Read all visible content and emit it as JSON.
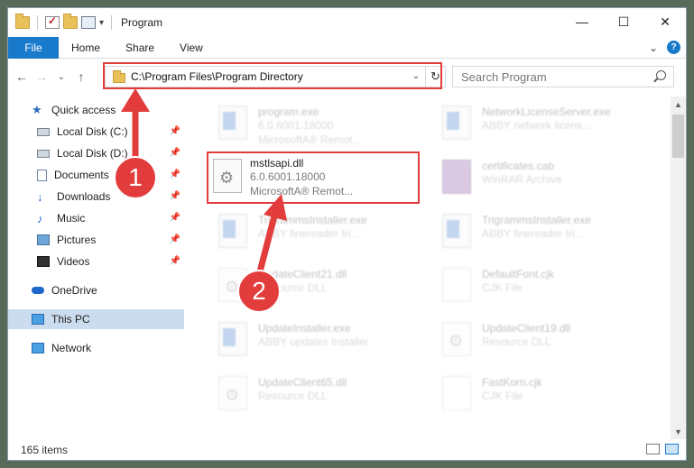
{
  "window": {
    "title": "Program",
    "controls": {
      "minimize": "—",
      "maximize": "☐",
      "close": "✕"
    }
  },
  "ribbon": {
    "tabs": [
      {
        "label": "File"
      },
      {
        "label": "Home"
      },
      {
        "label": "Share"
      },
      {
        "label": "View"
      }
    ],
    "chevron": "⌄",
    "help": "?"
  },
  "nav": {
    "back": "←",
    "forward": "→",
    "recent": "⌄",
    "up": "↑",
    "address": "C:\\Program Files\\Program Directory",
    "dropdown": "⌄",
    "refresh": "↻",
    "search_placeholder": "Search Program"
  },
  "sidebar": {
    "items": [
      {
        "label": "Quick access",
        "icon": "star-icon"
      },
      {
        "label": "Local Disk (C:)",
        "icon": "disk-icon",
        "pinned": true
      },
      {
        "label": "Local Disk (D:)",
        "icon": "disk-icon",
        "pinned": true
      },
      {
        "label": "Documents",
        "icon": "documents-icon",
        "pinned": true
      },
      {
        "label": "Downloads",
        "icon": "downloads-icon",
        "pinned": true
      },
      {
        "label": "Music",
        "icon": "music-icon",
        "pinned": true
      },
      {
        "label": "Pictures",
        "icon": "pictures-icon",
        "pinned": true
      },
      {
        "label": "Videos",
        "icon": "videos-icon",
        "pinned": true
      },
      {
        "label": "OneDrive",
        "icon": "onedrive-icon"
      },
      {
        "label": "This PC",
        "icon": "this-pc-icon",
        "selected": true
      },
      {
        "label": "Network",
        "icon": "network-icon"
      }
    ],
    "pin_glyph": "📌"
  },
  "files": [
    {
      "name": "program.exe",
      "line1": "6.0.6001.18000",
      "line2": "MicrosoftA® Remot...",
      "icon": "exe"
    },
    {
      "name": "NetworkLicenseServer.exe",
      "line1": "ABBY network licens...",
      "line2": "",
      "icon": "exe"
    },
    {
      "name": "mstlsapi.dll",
      "line1": "6.0.6001.18000",
      "line2": "MicrosoftA® Remot...",
      "icon": "dll",
      "highlighted": true
    },
    {
      "name": "certificates.cab",
      "line1": "WinRAR Archive",
      "line2": "",
      "icon": "rar"
    },
    {
      "name": "TrigrammsInstaller.exe",
      "line1": "ABBY finereader tri...",
      "line2": "",
      "icon": "exe"
    },
    {
      "name": "TrigrammsInstaller.exe",
      "line1": "ABBY finereader tri...",
      "line2": "",
      "icon": "exe"
    },
    {
      "name": "UpdateClient21.dll",
      "line1": "Resource DLL",
      "line2": "",
      "icon": "dll"
    },
    {
      "name": "DefaultFont.cjk",
      "line1": "CJK File",
      "line2": "",
      "icon": "doc"
    },
    {
      "name": "UpdateInstaller.exe",
      "line1": "ABBY updates installer",
      "line2": "",
      "icon": "exe"
    },
    {
      "name": "UpdateClient19.dll",
      "line1": "Resource DLL",
      "line2": "",
      "icon": "dll"
    },
    {
      "name": "UpdateClient65.dll",
      "line1": "Resource DLL",
      "line2": "",
      "icon": "dll"
    },
    {
      "name": "FastKorn.cjk",
      "line1": "CJK File",
      "line2": "",
      "icon": "doc"
    }
  ],
  "status": {
    "count": "165 items"
  },
  "annotations": {
    "step1": "1",
    "step2": "2",
    "color": "#e23c3c"
  }
}
